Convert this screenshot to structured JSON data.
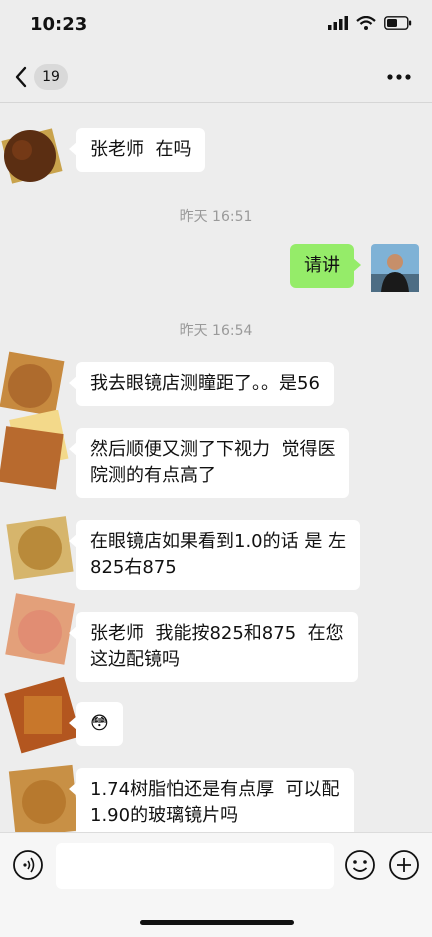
{
  "status_bar": {
    "time": "10:23"
  },
  "nav": {
    "unread_count": "19"
  },
  "messages": [
    {
      "side": "left",
      "text": "张老师  在吗"
    },
    {
      "timestamp": "昨天 16:51"
    },
    {
      "side": "right",
      "text": "请讲"
    },
    {
      "timestamp": "昨天 16:54"
    },
    {
      "side": "left",
      "text": "我去眼镜店测瞳距了。。是56"
    },
    {
      "side": "left",
      "text": "然后顺便又测了下视力  觉得医\n院测的有点高了"
    },
    {
      "side": "left",
      "text": "在眼镜店如果看到1.0的话 是 左\n825右875"
    },
    {
      "side": "left",
      "text": "张老师  我能按825和875  在您\n这边配镜吗"
    },
    {
      "side": "left",
      "text": "😳"
    },
    {
      "side": "left",
      "text": "1.74树脂怕还是有点厚  可以配\n1.90的玻璃镜片吗"
    }
  ],
  "colors": {
    "sent_bubble": "#95ec69",
    "received_bubble": "#ffffff",
    "background": "#ededed"
  },
  "icons": [
    "back-chevron-icon",
    "more-icon",
    "voice-icon",
    "emoji-icon",
    "plus-icon",
    "signal-icon",
    "wifi-icon",
    "battery-icon"
  ]
}
